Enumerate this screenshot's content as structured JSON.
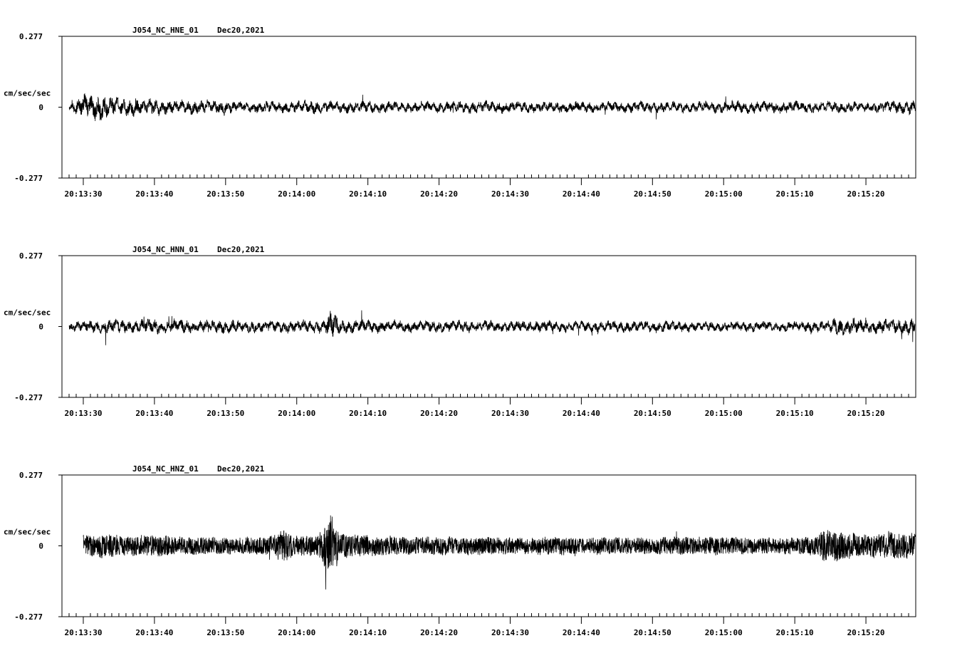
{
  "chart_data": [
    {
      "type": "line",
      "title": "J054_NC_HNE_01",
      "date": "Dec20,2021",
      "ylabel": "cm/sec/sec",
      "ylim": [
        -0.277,
        0.277
      ],
      "yticks": [
        "0.277",
        "0",
        "-0.277"
      ],
      "xlim_seconds": [
        -3,
        117
      ],
      "xticks": [
        "20:13:30",
        "20:13:40",
        "20:13:50",
        "20:14:00",
        "20:14:10",
        "20:14:20",
        "20:14:30",
        "20:14:40",
        "20:14:50",
        "20:15:00",
        "20:15:10",
        "20:15:20"
      ],
      "series": [
        {
          "start": -2,
          "envelope": [
            [
              -2,
              0.02
            ],
            [
              0,
              0.07
            ],
            [
              2,
              0.08
            ],
            [
              3,
              0.08
            ],
            [
              4,
              0.06
            ],
            [
              6,
              0.05
            ],
            [
              8,
              0.05
            ],
            [
              10,
              0.05
            ],
            [
              12,
              0.04
            ],
            [
              14,
              0.04
            ],
            [
              16,
              0.04
            ],
            [
              18,
              0.04
            ],
            [
              20,
              0.04
            ],
            [
              22,
              0.03
            ],
            [
              26,
              0.035
            ],
            [
              28,
              0.035
            ],
            [
              30,
              0.035
            ],
            [
              32,
              0.04
            ],
            [
              35,
              0.035
            ],
            [
              40,
              0.035
            ],
            [
              45,
              0.03
            ],
            [
              50,
              0.035
            ],
            [
              55,
              0.035
            ],
            [
              60,
              0.035
            ],
            [
              65,
              0.03
            ],
            [
              70,
              0.035
            ],
            [
              75,
              0.03
            ],
            [
              80,
              0.035
            ],
            [
              85,
              0.03
            ],
            [
              90,
              0.035
            ],
            [
              95,
              0.035
            ],
            [
              100,
              0.035
            ],
            [
              105,
              0.035
            ],
            [
              110,
              0.03
            ],
            [
              116,
              0.04
            ]
          ]
        }
      ]
    },
    {
      "type": "line",
      "title": "J054_NC_HNN_01",
      "date": "Dec20,2021",
      "ylabel": "cm/sec/sec",
      "ylim": [
        -0.277,
        0.277
      ],
      "yticks": [
        "0.277",
        "0",
        "-0.277"
      ],
      "xlim_seconds": [
        -3,
        117
      ],
      "xticks": [
        "20:13:30",
        "20:13:40",
        "20:13:50",
        "20:14:00",
        "20:14:10",
        "20:14:20",
        "20:14:30",
        "20:14:40",
        "20:14:50",
        "20:15:00",
        "20:15:10",
        "20:15:20"
      ],
      "series": [
        {
          "start": -2,
          "envelope": [
            [
              -2,
              0.03
            ],
            [
              2,
              0.04
            ],
            [
              5,
              0.045
            ],
            [
              8,
              0.04
            ],
            [
              11,
              0.045
            ],
            [
              15,
              0.04
            ],
            [
              20,
              0.04
            ],
            [
              25,
              0.035
            ],
            [
              30,
              0.035
            ],
            [
              34,
              0.04
            ],
            [
              35,
              0.1
            ],
            [
              36,
              0.045
            ],
            [
              40,
              0.04
            ],
            [
              45,
              0.035
            ],
            [
              50,
              0.035
            ],
            [
              55,
              0.035
            ],
            [
              60,
              0.035
            ],
            [
              65,
              0.035
            ],
            [
              70,
              0.03
            ],
            [
              75,
              0.035
            ],
            [
              80,
              0.035
            ],
            [
              85,
              0.03
            ],
            [
              90,
              0.03
            ],
            [
              95,
              0.03
            ],
            [
              100,
              0.03
            ],
            [
              104,
              0.035
            ],
            [
              106,
              0.055
            ],
            [
              108,
              0.05
            ],
            [
              110,
              0.04
            ],
            [
              113,
              0.045
            ],
            [
              116,
              0.05
            ]
          ]
        }
      ]
    },
    {
      "type": "line",
      "title": "J054_NC_HNZ_01",
      "date": "Dec20,2021",
      "ylabel": "cm/sec/sec",
      "ylim": [
        -0.277,
        0.277
      ],
      "yticks": [
        "0.277",
        "0",
        "-0.277"
      ],
      "xlim_seconds": [
        -3,
        117
      ],
      "xticks": [
        "20:13:30",
        "20:13:40",
        "20:13:50",
        "20:14:00",
        "20:14:10",
        "20:14:20",
        "20:14:30",
        "20:14:40",
        "20:14:50",
        "20:15:00",
        "20:15:10",
        "20:15:20"
      ],
      "series": [
        {
          "start": 0,
          "envelope": [
            [
              0,
              0.06
            ],
            [
              3,
              0.07
            ],
            [
              6,
              0.055
            ],
            [
              10,
              0.06
            ],
            [
              15,
              0.05
            ],
            [
              20,
              0.045
            ],
            [
              25,
              0.05
            ],
            [
              27,
              0.06
            ],
            [
              28,
              0.1
            ],
            [
              30,
              0.055
            ],
            [
              33,
              0.06
            ],
            [
              35,
              0.18
            ],
            [
              36,
              0.07
            ],
            [
              40,
              0.055
            ],
            [
              45,
              0.05
            ],
            [
              50,
              0.05
            ],
            [
              55,
              0.05
            ],
            [
              60,
              0.045
            ],
            [
              65,
              0.05
            ],
            [
              70,
              0.045
            ],
            [
              75,
              0.05
            ],
            [
              80,
              0.045
            ],
            [
              85,
              0.05
            ],
            [
              90,
              0.05
            ],
            [
              95,
              0.045
            ],
            [
              100,
              0.045
            ],
            [
              103,
              0.05
            ],
            [
              104,
              0.09
            ],
            [
              107,
              0.08
            ],
            [
              109,
              0.06
            ],
            [
              111,
              0.06
            ],
            [
              113,
              0.075
            ],
            [
              116,
              0.07
            ]
          ]
        }
      ]
    }
  ]
}
